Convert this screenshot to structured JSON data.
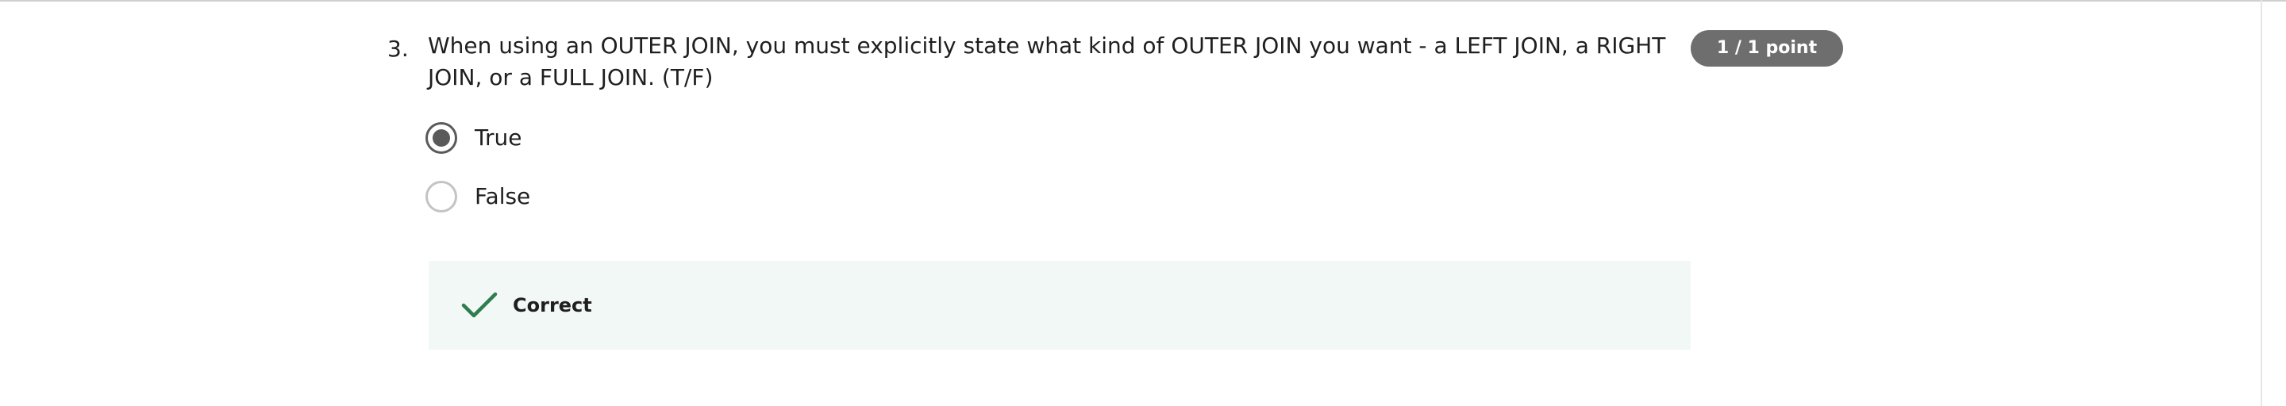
{
  "question": {
    "number": "3.",
    "text": "When using an OUTER JOIN, you must explicitly state what kind of OUTER JOIN  you want -  a LEFT JOIN, a RIGHT JOIN, or a FULL JOIN. (T/F)",
    "points": "1 / 1 point"
  },
  "options": [
    {
      "label": "True",
      "selected": true
    },
    {
      "label": "False",
      "selected": false
    }
  ],
  "feedback": {
    "icon": "check-icon",
    "label": "Correct",
    "accent_color": "#2e7d4f",
    "background_color": "#f2f8f5"
  },
  "colors": {
    "badge_bg": "#6e6e6e",
    "radio_selected": "#5a5a5a",
    "radio_unselected": "#c4c4c4"
  }
}
